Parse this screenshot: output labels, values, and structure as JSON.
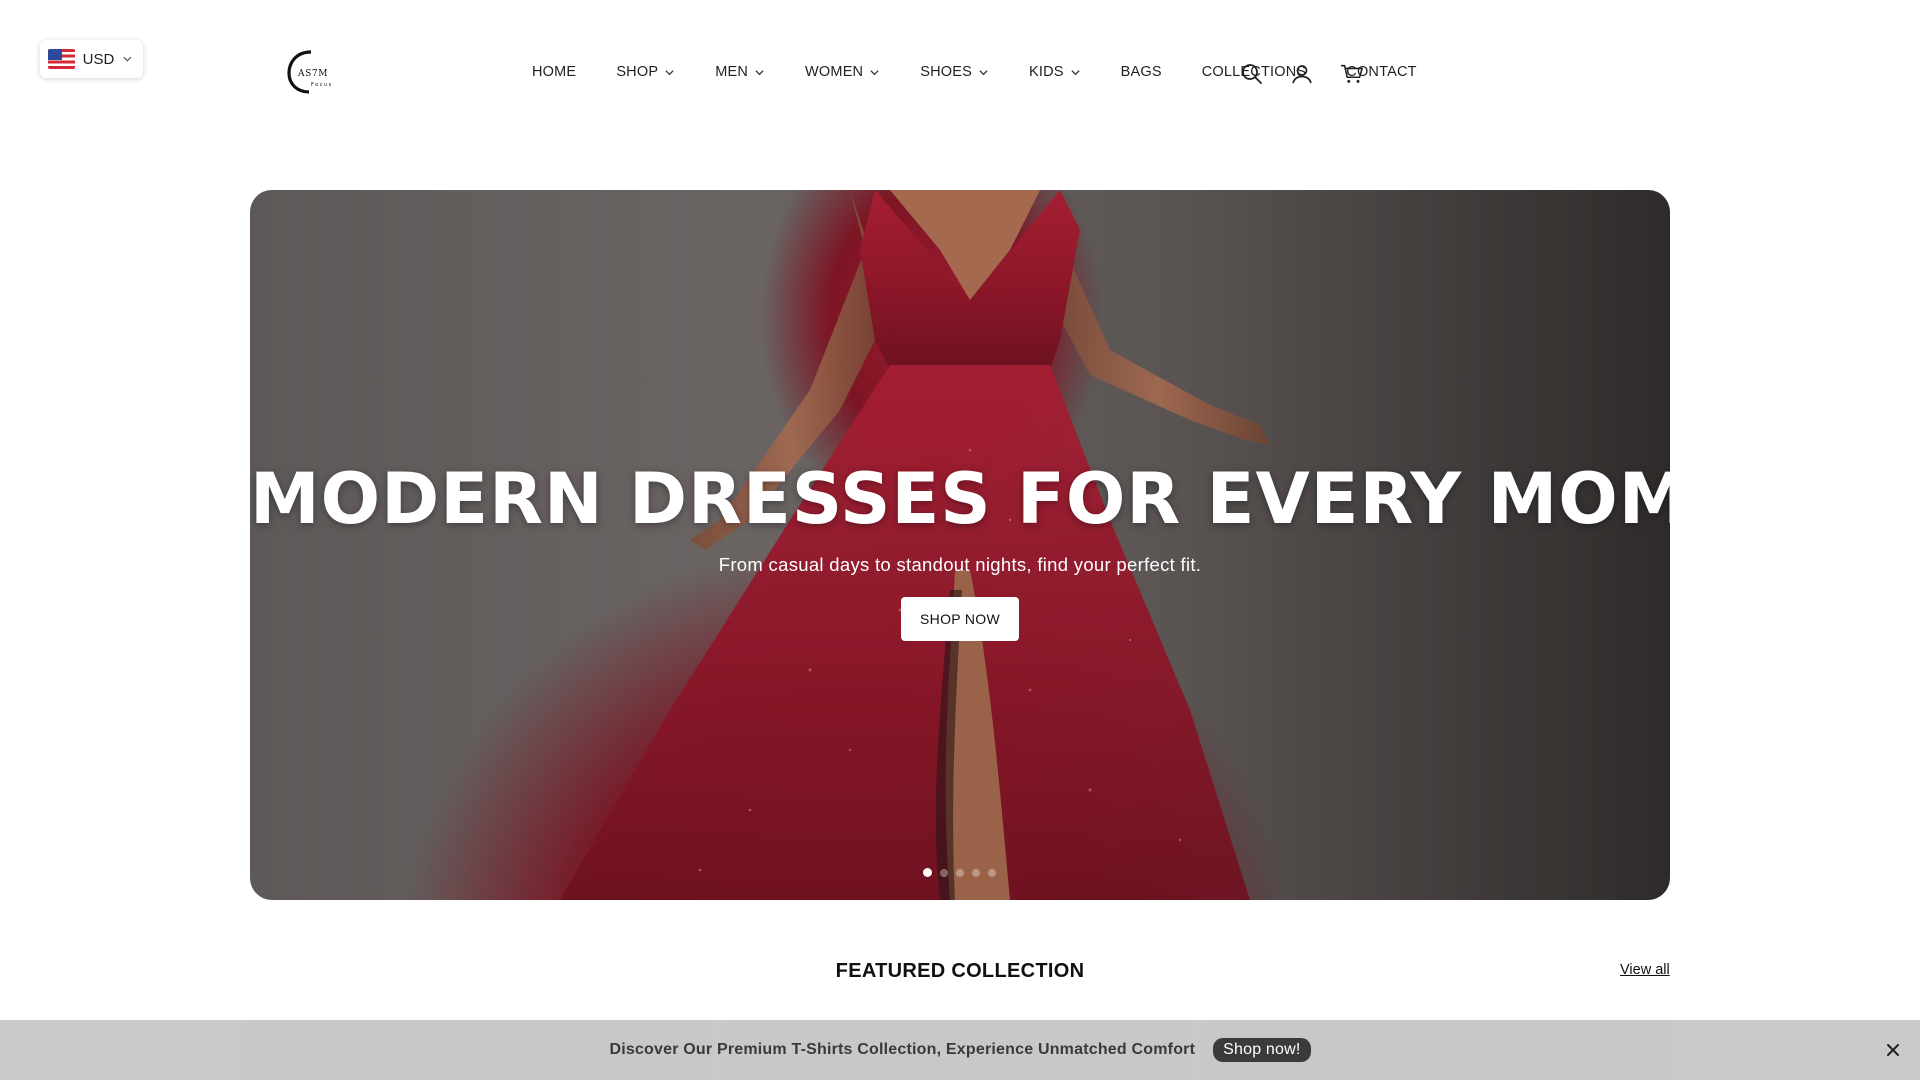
{
  "currency": {
    "code": "USD",
    "flag_icon": "us-flag-icon"
  },
  "header": {
    "logo_alt": "CASTM Focus",
    "nav": [
      {
        "label": "HOME",
        "dropdown": false
      },
      {
        "label": "SHOP",
        "dropdown": true
      },
      {
        "label": "MEN",
        "dropdown": true
      },
      {
        "label": "WOMEN",
        "dropdown": true
      },
      {
        "label": "SHOES",
        "dropdown": true
      },
      {
        "label": "KIDS",
        "dropdown": true
      },
      {
        "label": "BAGS",
        "dropdown": false
      },
      {
        "label": "COLLECTIONS",
        "dropdown": false
      },
      {
        "label": "CONTACT",
        "dropdown": false
      }
    ],
    "icons": [
      "search-icon",
      "account-icon",
      "cart-icon"
    ]
  },
  "hero": {
    "title": "MODERN DRESSES FOR EVERY MOMENT",
    "subtitle": "From casual days to standout nights, find your perfect fit.",
    "button_label": "SHOP NOW",
    "slide_count": 5,
    "active_slide": 1
  },
  "featured": {
    "title": "FEATURED COLLECTION",
    "view_all_label": "View all"
  },
  "announcement": {
    "text": "Discover Our Premium T-Shirts Collection, Experience Unmatched Comfort",
    "button_label": "Shop now!"
  },
  "colors": {
    "accent_dark": "#3b3b3b",
    "hero_dress": "#8b1628",
    "announcement_bg": "#c4c4c4"
  }
}
